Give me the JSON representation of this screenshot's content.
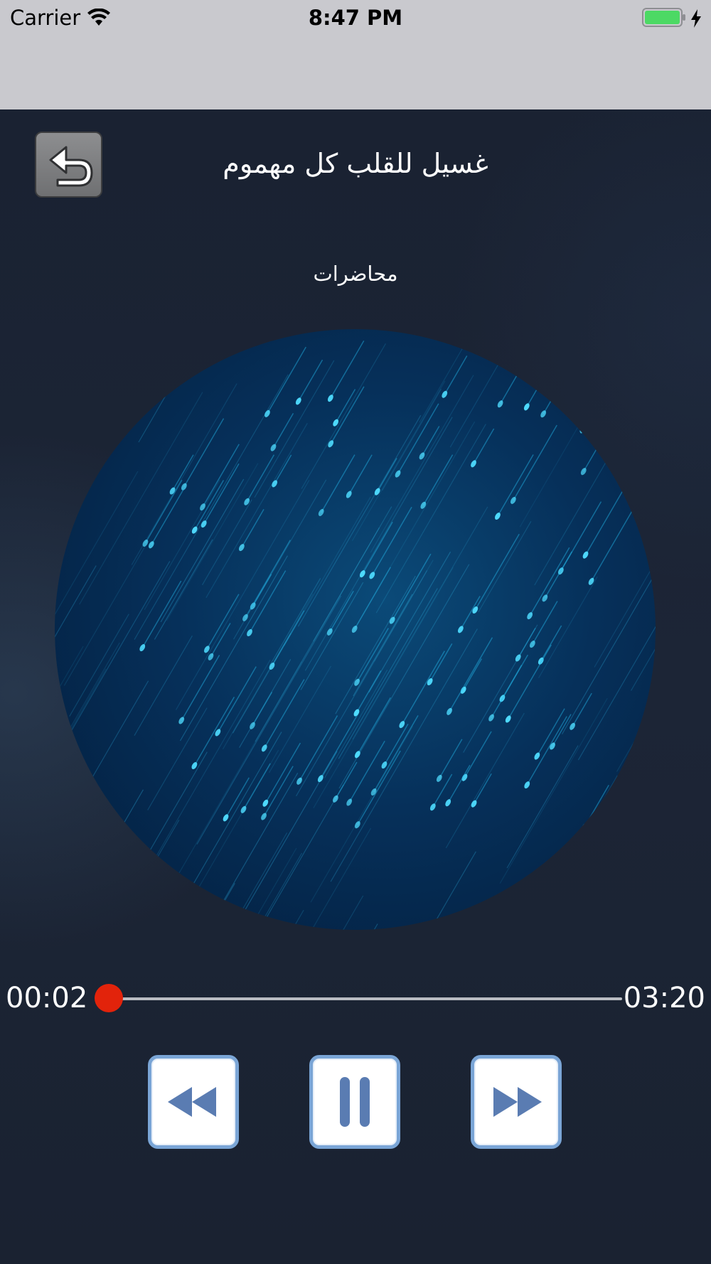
{
  "status_bar": {
    "carrier": "Carrier",
    "time": "8:47 PM",
    "battery_color": "#4cd964"
  },
  "header": {
    "back_icon": "undo-arrow-icon",
    "title": "غسيل للقلب كل مهموم",
    "category": "محاضرات"
  },
  "artwork": {
    "description_icon": "rain-streaks-artwork",
    "accent": "#1fb8e8"
  },
  "player": {
    "current_time": "00:02",
    "total_time": "03:20",
    "progress": 0.01,
    "progress_color": "#e2230b",
    "controls": {
      "rewind_icon": "rewind-icon",
      "pause_icon": "pause-icon",
      "forward_icon": "fast-forward-icon"
    }
  }
}
